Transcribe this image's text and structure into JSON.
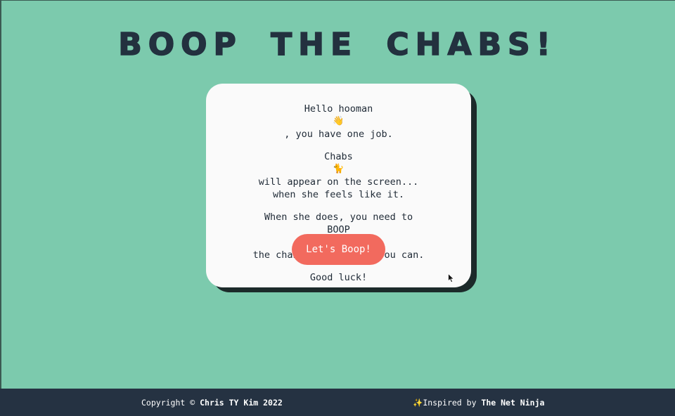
{
  "header": {
    "title": "BOOP THE CHABS!"
  },
  "card": {
    "line1_prefix": "Hello hooman",
    "line1_emoji": "👋",
    "line1_suffix": ", you have one job.",
    "line2_prefix": "Chabs",
    "line2_emoji": "🐈",
    "line2_suffix": " will appear on the screen...",
    "line3": "when she feels like it.",
    "line4": "When she does, you need to",
    "line5_prefix": "BOOP",
    "line5_emoji": "👆",
    "line5_suffix": " the chabs as quick as you can.",
    "line6": "Good luck!",
    "button_label": "Let's Boop!"
  },
  "footer": {
    "copyright_prefix": "Copyright © ",
    "copyright_name": "Chris TY Kim 2022",
    "inspired_icon": "✨",
    "inspired_prefix": "Inspired by ",
    "inspired_name": "The Net Ninja"
  },
  "colors": {
    "background": "#7ccaad",
    "title": "#23313f",
    "card": "#fafafa",
    "card_shadow": "#1c2a2a",
    "button": "#f26a5e",
    "footer": "#253242"
  }
}
